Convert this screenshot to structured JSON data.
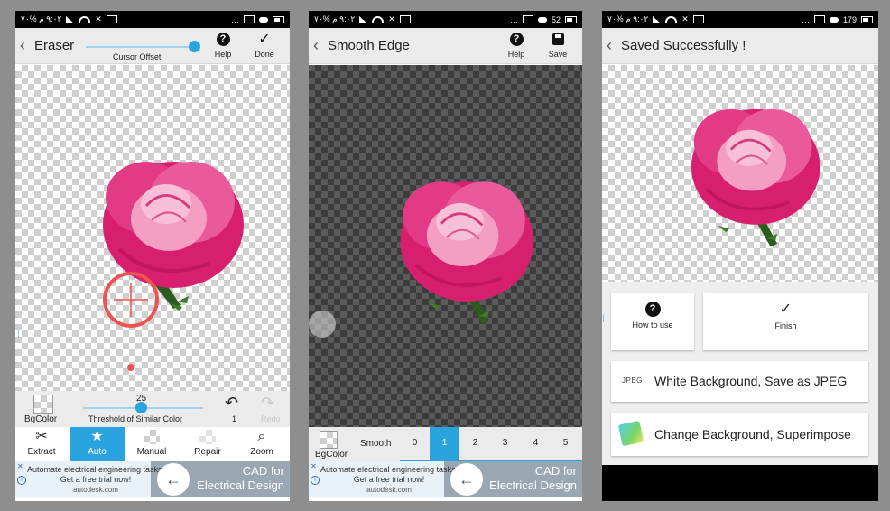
{
  "status_bars": [
    {
      "left": "٩:٠٢ م %٧٠",
      "right_speed": ""
    },
    {
      "left": "٩:٠٢ م %٧٠",
      "right_speed": "52"
    },
    {
      "left": "٩:٠٢ م %٧٠",
      "right_speed": "179"
    }
  ],
  "screen1": {
    "title": "Eraser",
    "cursor_offset_label": "Cursor Offset",
    "help_label": "Help",
    "done_label": "Done",
    "threshold_value": "25",
    "threshold_label": "Threshold of Similar Color",
    "bgcolor_label": "BgColor",
    "undo_count": "1",
    "redo_label": "Redo",
    "tools": [
      {
        "label": "Extract",
        "icon": "scissors-icon",
        "active": false
      },
      {
        "label": "Auto",
        "icon": "star-icon",
        "active": true
      },
      {
        "label": "Manual",
        "icon": "checker-icon",
        "active": false
      },
      {
        "label": "Repair",
        "icon": "repair-icon",
        "active": false
      },
      {
        "label": "Zoom",
        "icon": "search-icon",
        "active": false
      }
    ]
  },
  "screen2": {
    "title": "Smooth Edge",
    "help_label": "Help",
    "save_label": "Save",
    "bgcolor_label": "BgColor",
    "smooth_label": "Smooth",
    "levels": [
      "0",
      "1",
      "2",
      "3",
      "4",
      "5"
    ],
    "selected_level": "1"
  },
  "screen3": {
    "title": "Saved Successfully !",
    "how_to_use_label": "How to use",
    "finish_label": "Finish",
    "jpeg_badge": "JPEG",
    "save_jpeg_label": "White Background, Save as JPEG",
    "change_bg_label": "Change Background, Superimpose"
  },
  "ad": {
    "line1": "Automate electrical engineering tasks. Get a free trial now!",
    "source": "autodesk.com",
    "cad_line1": "CAD for",
    "cad_line2": "Electrical Design"
  },
  "colors": {
    "accent": "#29a4df",
    "rose": "#e5337f",
    "toolbar": "#ebebeb"
  }
}
